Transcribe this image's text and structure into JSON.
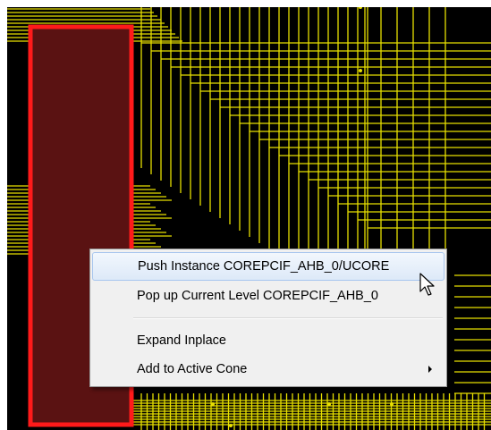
{
  "context_menu": {
    "items": [
      {
        "label": "Push Instance COREPCIF_AHB_0/UCORE",
        "highlighted": true
      },
      {
        "label": "Pop up Current Level COREPCIF_AHB_0",
        "highlighted": false
      },
      {
        "label": "Expand Inplace",
        "highlighted": false
      },
      {
        "label": "Add to Active Cone",
        "highlighted": false,
        "has_submenu": true
      }
    ]
  },
  "colors": {
    "canvas_bg": "#000000",
    "wire": "#e8e000",
    "block_fill": "#5a1212",
    "block_border": "#ff1a1a",
    "menu_bg": "#f0f0f0",
    "menu_highlight": "#dde9f8"
  },
  "icons": {
    "submenu": "chevron-right-icon",
    "cursor": "mouse-pointer-icon"
  }
}
